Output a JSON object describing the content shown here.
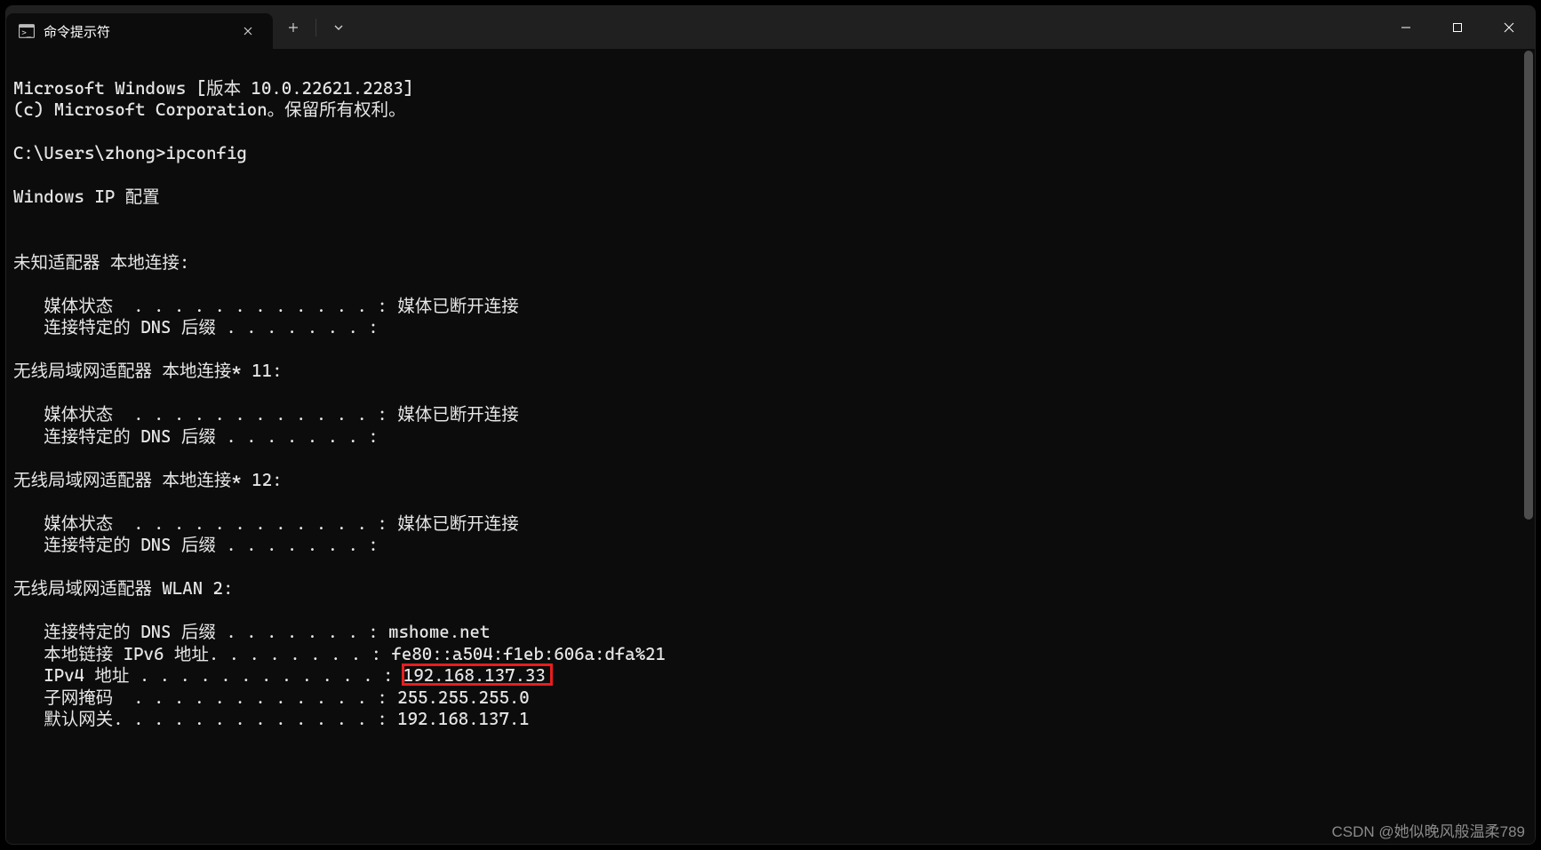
{
  "titlebar": {
    "tab_title": "命令提示符",
    "close_tab_tooltip": "Close tab",
    "new_tab_tooltip": "New tab",
    "dropdown_tooltip": "Tab options"
  },
  "window_controls": {
    "minimize": "Minimize",
    "maximize": "Maximize",
    "close": "Close"
  },
  "terminal": {
    "line01": "Microsoft Windows [版本 10.0.22621.2283]",
    "line02": "(c) Microsoft Corporation。保留所有权利。",
    "line03": "",
    "line04": "C:\\Users\\zhong>ipconfig",
    "line05": "",
    "line06": "Windows IP 配置",
    "line07": "",
    "line08": "",
    "line09": "未知适配器 本地连接:",
    "line10": "",
    "line11": "   媒体状态  . . . . . . . . . . . . : 媒体已断开连接",
    "line12": "   连接特定的 DNS 后缀 . . . . . . . :",
    "line13": "",
    "line14": "无线局域网适配器 本地连接* 11:",
    "line15": "",
    "line16": "   媒体状态  . . . . . . . . . . . . : 媒体已断开连接",
    "line17": "   连接特定的 DNS 后缀 . . . . . . . :",
    "line18": "",
    "line19": "无线局域网适配器 本地连接* 12:",
    "line20": "",
    "line21": "   媒体状态  . . . . . . . . . . . . : 媒体已断开连接",
    "line22": "   连接特定的 DNS 后缀 . . . . . . . :",
    "line23": "",
    "line24": "无线局域网适配器 WLAN 2:",
    "line25": "",
    "line26": "   连接特定的 DNS 后缀 . . . . . . . : mshome.net",
    "line27": "   本地链接 IPv6 地址. . . . . . . . : fe80::a504:f1eb:606a:dfa%21",
    "line28": "   IPv4 地址 . . . . . . . . . . . . : 192.168.137.33",
    "line29": "   子网掩码  . . . . . . . . . . . . : 255.255.255.0",
    "line30": "   默认网关. . . . . . . . . . . . . : 192.168.137.1"
  },
  "highlight": {
    "target_value": "192.168.137.33"
  },
  "watermark": "CSDN @她似晚风般温柔789"
}
